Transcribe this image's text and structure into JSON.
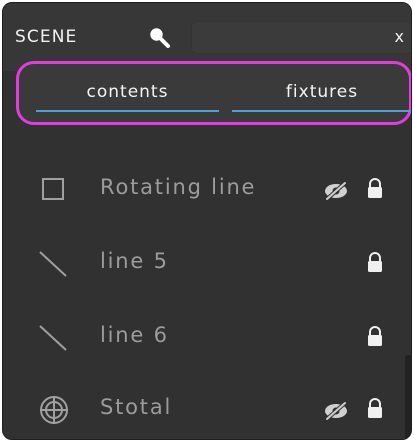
{
  "panel": {
    "title": "SCENE",
    "search": {
      "value": "",
      "placeholder": "",
      "clear_label": "x"
    },
    "tabs": [
      {
        "label": "contents",
        "active": true
      },
      {
        "label": "fixtures",
        "active": false
      }
    ],
    "items": [
      {
        "label": "Rotating line",
        "icon": "square-icon",
        "hidden": true,
        "locked": true
      },
      {
        "label": "line 5",
        "icon": "line-icon",
        "hidden": false,
        "locked": true
      },
      {
        "label": "line 6",
        "icon": "line-icon",
        "hidden": false,
        "locked": true
      },
      {
        "label": "Stotal",
        "icon": "target-icon",
        "hidden": true,
        "locked": true
      }
    ],
    "colors": {
      "background": "#313131",
      "header": "#373737",
      "text": "#9c9c9c",
      "highlight": "#e23ce0",
      "tab_underline": "#4d9fd8"
    }
  }
}
